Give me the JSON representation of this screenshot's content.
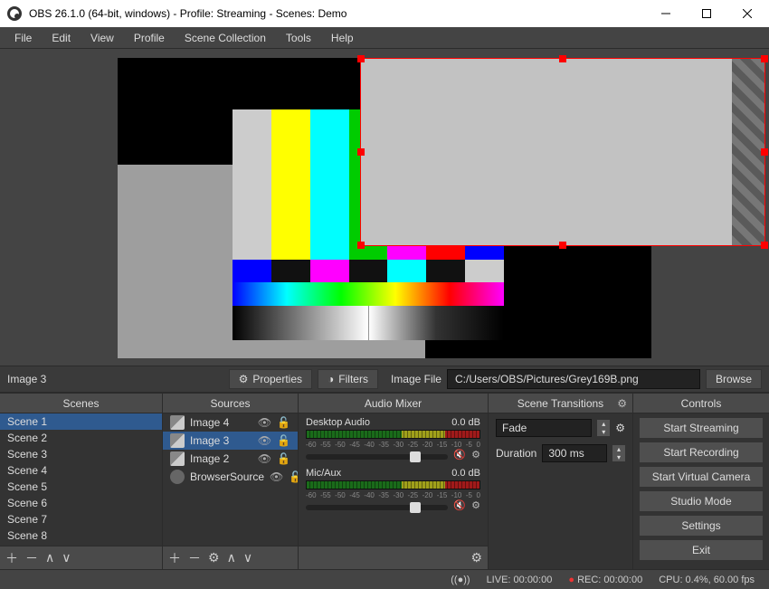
{
  "title": "OBS 26.1.0 (64-bit, windows) - Profile: Streaming - Scenes: Demo",
  "menu": [
    "File",
    "Edit",
    "View",
    "Profile",
    "Scene Collection",
    "Tools",
    "Help"
  ],
  "toolbar": {
    "selected_source": "Image 3",
    "properties": "Properties",
    "filters": "Filters",
    "path_label": "Image File",
    "path_value": "C:/Users/OBS/Pictures/Grey169B.png",
    "browse": "Browse"
  },
  "docks": {
    "scenes": {
      "title": "Scenes",
      "items": [
        "Scene 1",
        "Scene 2",
        "Scene 3",
        "Scene 4",
        "Scene 5",
        "Scene 6",
        "Scene 7",
        "Scene 8"
      ],
      "selected": 0
    },
    "sources": {
      "title": "Sources",
      "items": [
        "Image 4",
        "Image 3",
        "Image 2",
        "BrowserSource"
      ],
      "selected": 1
    },
    "mixer": {
      "title": "Audio Mixer",
      "channels": [
        {
          "name": "Desktop Audio",
          "db": "0.0 dB",
          "ticks": [
            "-60",
            "-55",
            "-50",
            "-45",
            "-40",
            "-35",
            "-30",
            "-25",
            "-20",
            "-15",
            "-10",
            "-5",
            "0"
          ]
        },
        {
          "name": "Mic/Aux",
          "db": "0.0 dB",
          "ticks": [
            "-60",
            "-55",
            "-50",
            "-45",
            "-40",
            "-35",
            "-30",
            "-25",
            "-20",
            "-15",
            "-10",
            "-5",
            "0"
          ]
        }
      ]
    },
    "transitions": {
      "title": "Scene Transitions",
      "type": "Fade",
      "duration_label": "Duration",
      "duration": "300 ms"
    },
    "controls": {
      "title": "Controls",
      "buttons": [
        "Start Streaming",
        "Start Recording",
        "Start Virtual Camera",
        "Studio Mode",
        "Settings",
        "Exit"
      ]
    }
  },
  "status": {
    "live": "LIVE: 00:00:00",
    "rec": "REC: 00:00:00",
    "cpu": "CPU: 0.4%, 60.00 fps"
  }
}
